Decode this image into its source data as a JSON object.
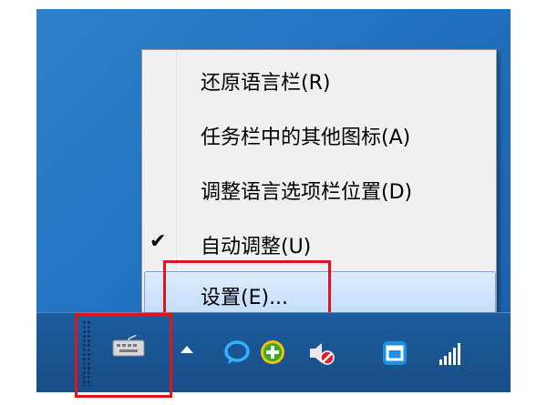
{
  "menu": {
    "items": [
      {
        "label": "还原语言栏(R)",
        "checked": false,
        "highlighted": false
      },
      {
        "label": "任务栏中的其他图标(A)",
        "checked": false,
        "highlighted": false
      },
      {
        "label": "调整语言选项栏位置(D)",
        "checked": false,
        "highlighted": false
      },
      {
        "label": "自动调整(U)",
        "checked": true,
        "highlighted": false
      },
      {
        "label": "设置(E)...",
        "checked": false,
        "highlighted": true
      }
    ],
    "check_glyph": "✔"
  },
  "tray": {
    "icons": [
      {
        "name": "show-hidden-icons",
        "glyph": "▲"
      },
      {
        "name": "chat-bubble-icon"
      },
      {
        "name": "green-plus-security-icon"
      },
      {
        "name": "volume-muted-icon"
      },
      {
        "name": "remote-window-icon"
      },
      {
        "name": "network-signal-icon"
      }
    ]
  },
  "colors": {
    "desktop": "#2272c0",
    "taskbar": "#1b5592",
    "highlight": "#c1dcfc",
    "annotation": "#e0141c"
  }
}
